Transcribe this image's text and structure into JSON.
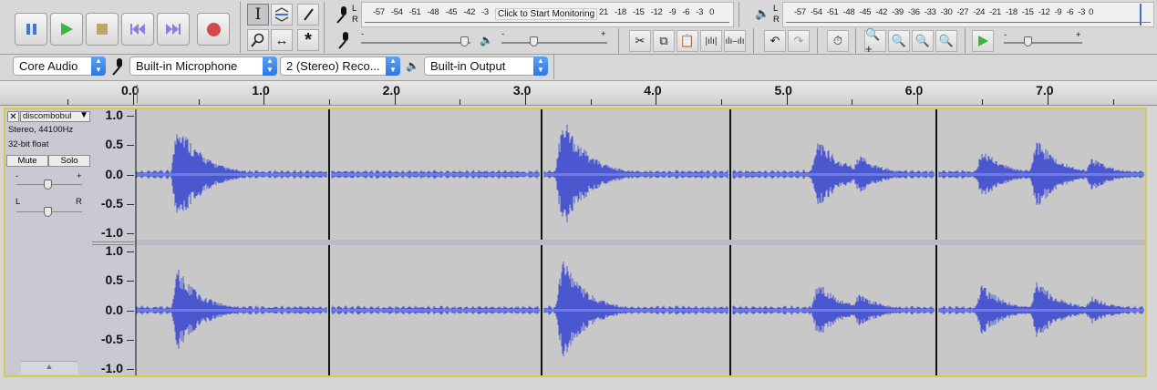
{
  "transport": {
    "pause_icon": "pause-icon",
    "play_icon": "play-icon",
    "stop_icon": "stop-icon",
    "skip_start_icon": "skip-to-start-icon",
    "skip_end_icon": "skip-to-end-icon",
    "record_icon": "record-icon"
  },
  "tools": [
    "selection-tool",
    "envelope-tool",
    "draw-tool",
    "zoom-tool",
    "timeshift-tool",
    "multi-tool"
  ],
  "record_meter": {
    "channel_labels": [
      "L",
      "R"
    ],
    "scale": [
      "-57",
      "-54",
      "-51",
      "-48",
      "-45",
      "-42",
      "-3"
    ],
    "scale_right": [
      "21",
      "-18",
      "-15",
      "-12",
      "-9",
      "-6",
      "-3",
      "0"
    ],
    "monitor_text": "Click to Start Monitoring"
  },
  "play_meter": {
    "channel_labels": [
      "L",
      "R"
    ],
    "scale": [
      "-57",
      "-54",
      "-51",
      "-48",
      "-45",
      "-42",
      "-39",
      "-36",
      "-33",
      "-30",
      "-27",
      "-24",
      "-21",
      "-18",
      "-15",
      "-12",
      "-9",
      "-6",
      "-3",
      "0"
    ]
  },
  "mixer": {
    "slider_minus": "-",
    "slider_plus": "+"
  },
  "play_at_speed": {
    "minus": "-",
    "plus": "+"
  },
  "devices": {
    "host": "Core Audio",
    "recording_device": "Built-in Microphone",
    "channels": "2 (Stereo) Reco...",
    "playback_device": "Built-in Output"
  },
  "ruler": {
    "labels": [
      "0.0",
      "1.0",
      "2.0",
      "3.0",
      "4.0",
      "5.0",
      "6.0",
      "7.0"
    ]
  },
  "track": {
    "name": "discombobul",
    "info_line1": "Stereo, 44100Hz",
    "info_line2": "32-bit float",
    "mute": "Mute",
    "solo": "Solo",
    "gain_minus": "-",
    "gain_plus": "+",
    "pan_left": "L",
    "pan_right": "R",
    "amp_labels": [
      "1.0",
      "0.5",
      "0.0",
      "-0.5",
      "-1.0"
    ],
    "amp_labels_bottom": [
      "1.0",
      "0.5",
      "0.0",
      "-0.5",
      "-1.0"
    ]
  },
  "colors": {
    "waveform": "#4a57cf",
    "waveform_light": "#6d7be6",
    "selection_border": "#d4cb53",
    "track_bg": "#c8c8c8"
  }
}
